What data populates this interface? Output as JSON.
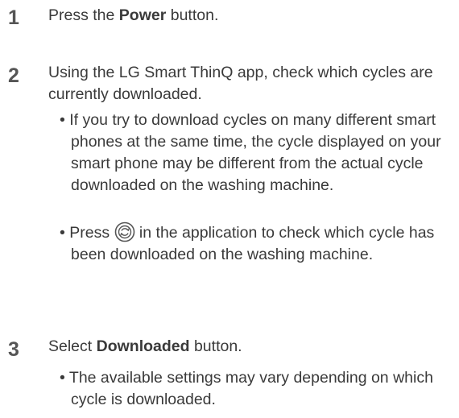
{
  "steps": [
    {
      "number": "1",
      "text_before": "Press the ",
      "text_bold": "Power",
      "text_after": " button."
    },
    {
      "number": "2",
      "text": "Using the LG Smart ThinQ app, check which cycles are currently downloaded.",
      "bullets": [
        {
          "marker": "•",
          "text": "If you try to download cycles on many different smart phones at the same time, the cycle displayed on your smart phone may be different from the actual cycle downloaded on the washing machine."
        },
        {
          "marker": "•",
          "text_before": "Press ",
          "icon": "cycle-refresh-icon",
          "text_after": " in the application to check which cycle has been downloaded on the washing machine."
        }
      ]
    },
    {
      "number": "3",
      "text_before": "Select ",
      "text_bold": "Downloaded",
      "text_after": " button.",
      "bullets": [
        {
          "marker": "•",
          "text": "The available settings may vary depending on which cycle is downloaded."
        }
      ]
    }
  ]
}
